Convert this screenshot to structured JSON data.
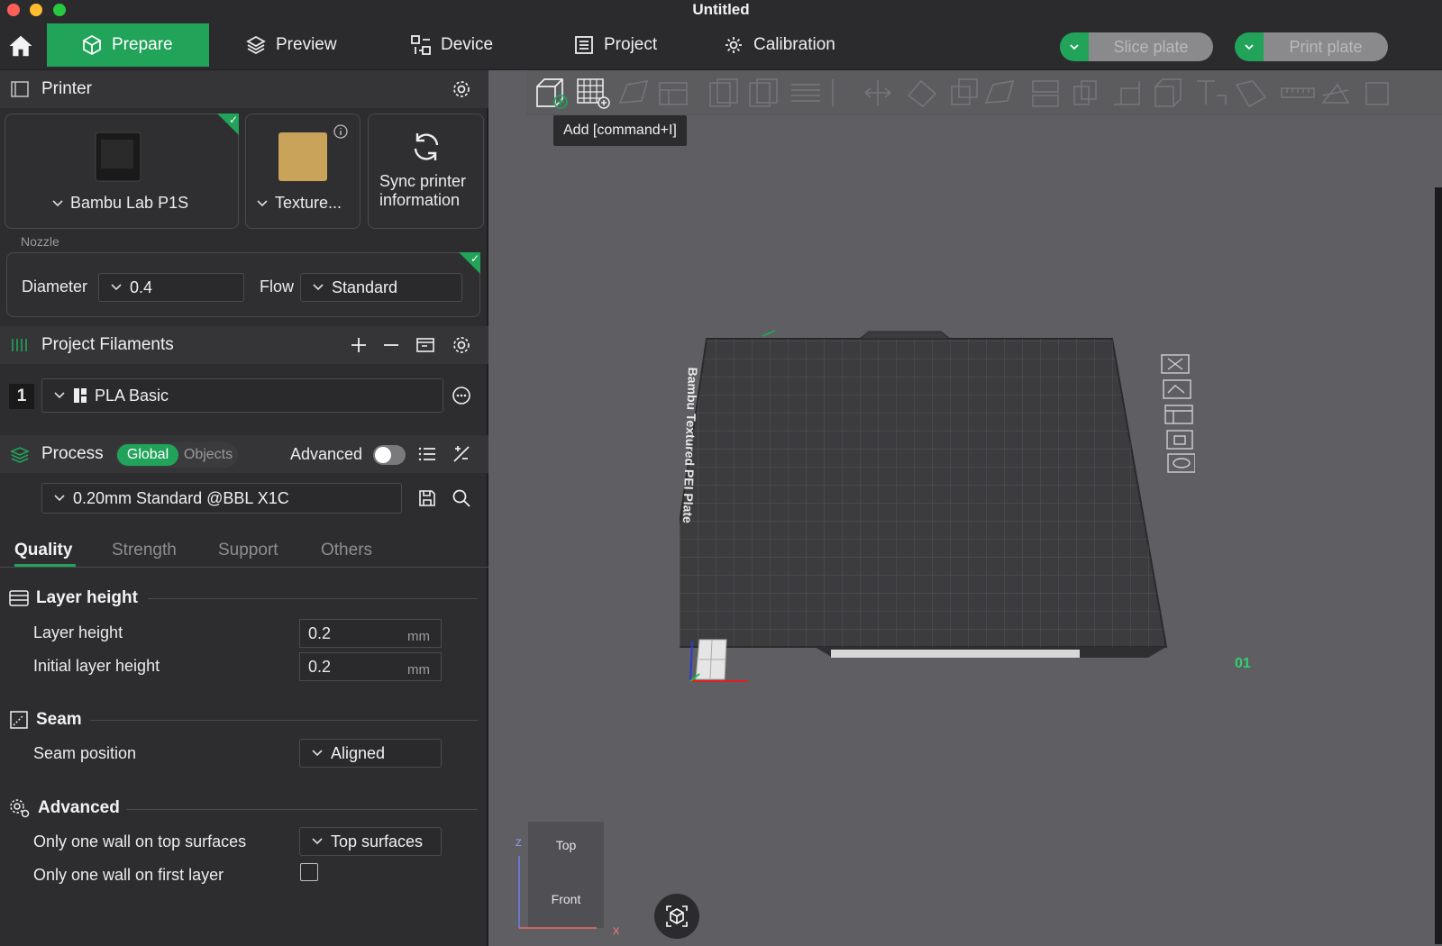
{
  "window": {
    "title": "Untitled"
  },
  "tabs": [
    {
      "label": "Prepare",
      "icon": "cube-icon",
      "active": true
    },
    {
      "label": "Preview",
      "icon": "layers-icon"
    },
    {
      "label": "Device",
      "icon": "device-icon"
    },
    {
      "label": "Project",
      "icon": "list-icon"
    },
    {
      "label": "Calibration",
      "icon": "gear-icon"
    }
  ],
  "actions": {
    "slice_plate": "Slice plate",
    "print_plate": "Print plate"
  },
  "printer": {
    "header": "Printer",
    "model": "Bambu Lab P1S",
    "plate": "Texture...",
    "sync_line1": "Sync printer",
    "sync_line2": "information",
    "nozzle_label": "Nozzle",
    "diameter_label": "Diameter",
    "diameter_value": "0.4",
    "flow_label": "Flow",
    "flow_value": "Standard"
  },
  "filaments": {
    "header": "Project Filaments",
    "items": [
      {
        "index": "1",
        "name": "PLA Basic"
      }
    ]
  },
  "process": {
    "header": "Process",
    "global": "Global",
    "objects": "Objects",
    "advanced": "Advanced",
    "advanced_on": false,
    "preset": "0.20mm Standard @BBL X1C"
  },
  "subtabs": [
    "Quality",
    "Strength",
    "Support",
    "Others"
  ],
  "quality": {
    "layer_group": "Layer height",
    "layer_height_label": "Layer height",
    "layer_height_value": "0.2",
    "initial_layer_label": "Initial layer height",
    "initial_layer_value": "0.2",
    "unit": "mm",
    "seam_group": "Seam",
    "seam_position_label": "Seam position",
    "seam_position_value": "Aligned",
    "advanced_group": "Advanced",
    "one_wall_top_label": "Only one wall on top surfaces",
    "one_wall_top_value": "Top surfaces",
    "one_wall_first_label": "Only one wall on first layer",
    "one_wall_first_checked": false
  },
  "viewport": {
    "tooltip": "Add [command+I]",
    "plate_label": "Bambu Textured PEI Plate",
    "plate_number": "01",
    "nav_top": "Top",
    "nav_front": "Front",
    "axis_z": "Z",
    "axis_x": "X"
  },
  "colors": {
    "accent": "#21a35a",
    "panel": "#2d2d2f",
    "viewport": "#5f5f63"
  }
}
